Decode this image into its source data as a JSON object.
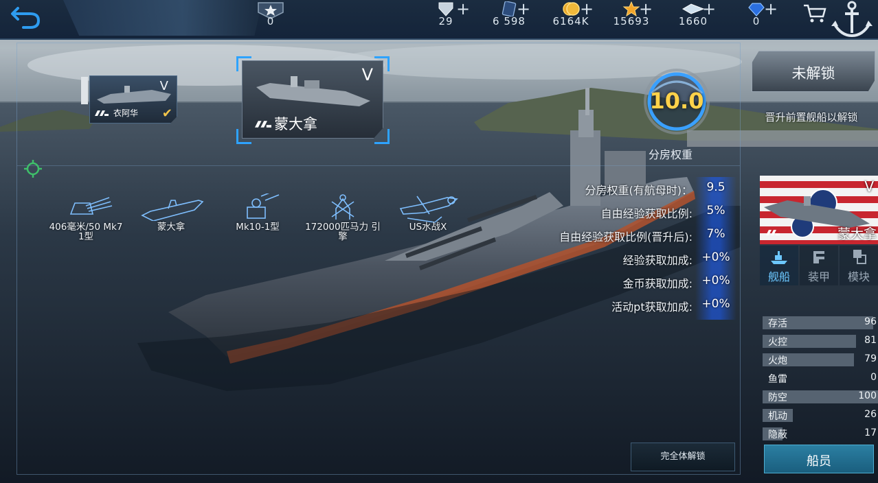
{
  "topbar": {
    "rank_value": "0",
    "resources": [
      {
        "icon": "diamond-icon",
        "value": "29"
      },
      {
        "icon": "blueprint-card-icon",
        "value": "6 598"
      },
      {
        "icon": "gold-coin-icon",
        "value": "6164K"
      },
      {
        "icon": "star-icon",
        "value": "15693"
      },
      {
        "icon": "crystal-icon",
        "value": "1660"
      },
      {
        "icon": "blue-gem-icon",
        "value": "0"
      }
    ],
    "plus_label": "+"
  },
  "ships": {
    "small": {
      "tier": "V",
      "name": "衣阿华"
    },
    "selected": {
      "tier": "V",
      "name": "蒙大拿"
    }
  },
  "level": {
    "value": "10.0",
    "label": "分房权重"
  },
  "stats": [
    {
      "label": "分房权重(有航母时)：",
      "value": "9.5"
    },
    {
      "label": "自由经验获取比例:",
      "value": "5%"
    },
    {
      "label": "自由经验获取比例(晋升后):",
      "value": "7%"
    },
    {
      "label": "经验获取加成:",
      "value": "+0%"
    },
    {
      "label": "金币获取加成:",
      "value": "+0%"
    },
    {
      "label": "活动pt获取加成:",
      "value": "+0%"
    }
  ],
  "equipment": [
    {
      "icon": "turret-icon",
      "label": "406毫米/50 Mk7 1型"
    },
    {
      "icon": "hull-icon",
      "label": "蒙大拿"
    },
    {
      "icon": "radar-icon",
      "label": "Mk10-1型"
    },
    {
      "icon": "engine-icon",
      "label": "172000匹马力 引擎"
    },
    {
      "icon": "seaplane-icon",
      "label": "US水战X"
    }
  ],
  "unlock_all_label": "完全体解锁",
  "right_panel": {
    "locked_label": "未解锁",
    "hint": "晋升前置舰船以解锁",
    "ship": {
      "tier": "V",
      "name": "蒙大拿"
    },
    "tabs": [
      {
        "icon": "ship-icon",
        "label": "舰船",
        "active": true
      },
      {
        "icon": "armor-icon",
        "label": "装甲",
        "active": false
      },
      {
        "icon": "module-icon",
        "label": "模块",
        "active": false
      }
    ],
    "attributes": [
      {
        "label": "存活",
        "value": "96",
        "fill": 0.96
      },
      {
        "label": "火控",
        "value": "81",
        "fill": 0.81
      },
      {
        "label": "火炮",
        "value": "79",
        "fill": 0.79
      },
      {
        "label": "鱼雷",
        "value": "0",
        "fill": 0
      },
      {
        "label": "防空",
        "value": "100",
        "fill": 1.0
      },
      {
        "label": "机动",
        "value": "26",
        "fill": 0.26
      },
      {
        "label": "隐蔽",
        "value": "17",
        "fill": 0.17
      }
    ],
    "crew_label": "船员"
  },
  "colors": {
    "accent": "#2ea3ff",
    "level_gold": "#ffd24a",
    "stat_bar": "#566371"
  }
}
